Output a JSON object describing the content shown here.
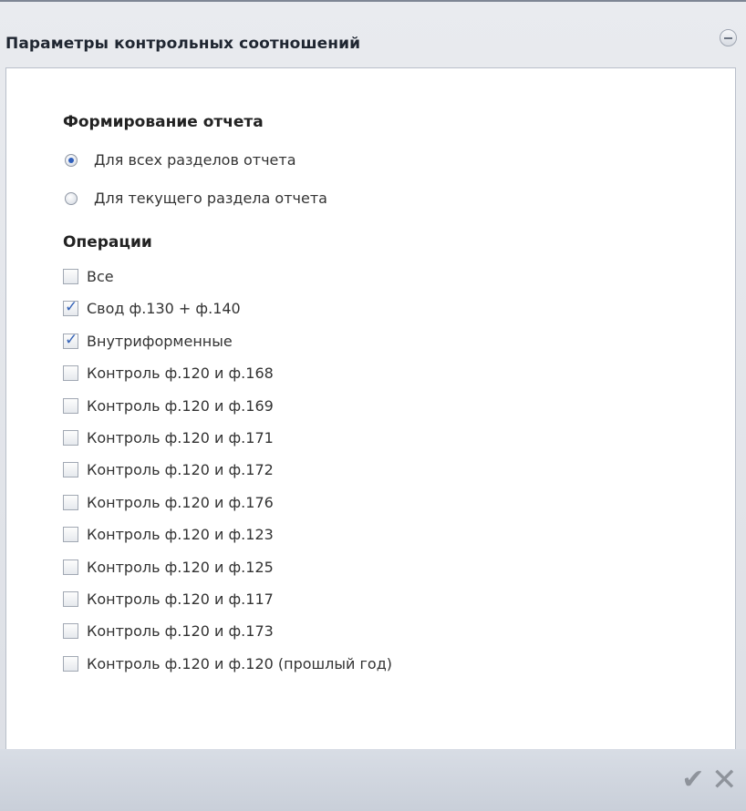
{
  "dialog": {
    "title": "Параметры контрольных соотношений",
    "icons": {
      "collapse": "circle-minus",
      "ok": "check-mark",
      "cancel": "x-mark"
    },
    "report_section": {
      "title": "Формирование отчета",
      "options": [
        {
          "label": "Для всех разделов отчета",
          "selected": true
        },
        {
          "label": "Для текущего раздела отчета",
          "selected": false
        }
      ]
    },
    "operations_section": {
      "title": "Операции",
      "items": [
        {
          "label": "Все",
          "checked": false
        },
        {
          "label": "Свод ф.130 + ф.140",
          "checked": true
        },
        {
          "label": "Внутриформенные",
          "checked": true
        },
        {
          "label": "Контроль ф.120 и ф.168",
          "checked": false
        },
        {
          "label": "Контроль ф.120 и ф.169",
          "checked": false
        },
        {
          "label": "Контроль ф.120 и ф.171",
          "checked": false
        },
        {
          "label": "Контроль ф.120 и ф.172",
          "checked": false
        },
        {
          "label": "Контроль ф.120 и ф.176",
          "checked": false
        },
        {
          "label": "Контроль ф.120 и ф.123",
          "checked": false
        },
        {
          "label": "Контроль ф.120 и ф.125",
          "checked": false
        },
        {
          "label": "Контроль ф.120 и ф.117",
          "checked": false
        },
        {
          "label": "Контроль ф.120 и ф.173",
          "checked": false
        },
        {
          "label": "Контроль ф.120 и ф.120 (прошлый год)",
          "checked": false
        }
      ]
    }
  }
}
